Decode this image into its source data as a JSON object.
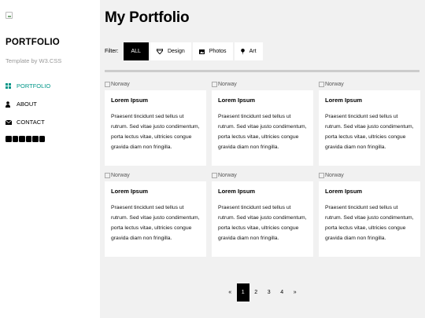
{
  "sidebar": {
    "brand": "PORTFOLIO",
    "byline": "Template by W3.CSS",
    "nav": [
      {
        "label": "PORTFOLIO",
        "icon": "grid-icon",
        "active": true
      },
      {
        "label": "ABOUT",
        "icon": "user-icon",
        "active": false
      },
      {
        "label": "CONTACT",
        "icon": "envelope-icon",
        "active": false
      }
    ],
    "socials": [
      "facebook-icon",
      "instagram-icon",
      "snapchat-icon",
      "pinterest-icon",
      "twitter-icon",
      "linkedin-icon"
    ]
  },
  "main": {
    "title": "My Portfolio",
    "filter": {
      "label": "Filter:",
      "buttons": [
        {
          "label": "ALL",
          "icon": "",
          "active": true
        },
        {
          "label": "Design",
          "icon": "diamond-icon",
          "active": false
        },
        {
          "label": "Photos",
          "icon": "photo-icon",
          "active": false
        },
        {
          "label": "Art",
          "icon": "map-marker-icon",
          "active": false
        }
      ]
    },
    "cards": [
      {
        "img_alt": "Norway",
        "title": "Lorem Ipsum",
        "text": "Praesent tincidunt sed tellus ut rutrum. Sed vitae justo condimentum, porta lectus vitae, ultricies congue gravida diam non fringilla."
      },
      {
        "img_alt": "Norway",
        "title": "Lorem Ipsum",
        "text": "Praesent tincidunt sed tellus ut rutrum. Sed vitae justo condimentum, porta lectus vitae, ultricies congue gravida diam non fringilla."
      },
      {
        "img_alt": "Norway",
        "title": "Lorem Ipsum",
        "text": "Praesent tincidunt sed tellus ut rutrum. Sed vitae justo condimentum, porta lectus vitae, ultricies congue gravida diam non fringilla."
      },
      {
        "img_alt": "Norway",
        "title": "Lorem Ipsum",
        "text": "Praesent tincidunt sed tellus ut rutrum. Sed vitae justo condimentum, porta lectus vitae, ultricies congue gravida diam non fringilla."
      },
      {
        "img_alt": "Norway",
        "title": "Lorem Ipsum",
        "text": "Praesent tincidunt sed tellus ut rutrum. Sed vitae justo condimentum, porta lectus vitae, ultricies congue gravida diam non fringilla."
      },
      {
        "img_alt": "Norway",
        "title": "Lorem Ipsum",
        "text": "Praesent tincidunt sed tellus ut rutrum. Sed vitae justo condimentum, porta lectus vitae, ultricies congue gravida diam non fringilla."
      }
    ],
    "pagination": {
      "prev": "«",
      "pages": [
        "1",
        "2",
        "3",
        "4"
      ],
      "current": "1",
      "next": "»"
    }
  },
  "colors": {
    "accent": "#009688",
    "page_bg": "#f1f1f1",
    "sidebar_bg": "#ffffff",
    "active_btn": "#000000"
  }
}
